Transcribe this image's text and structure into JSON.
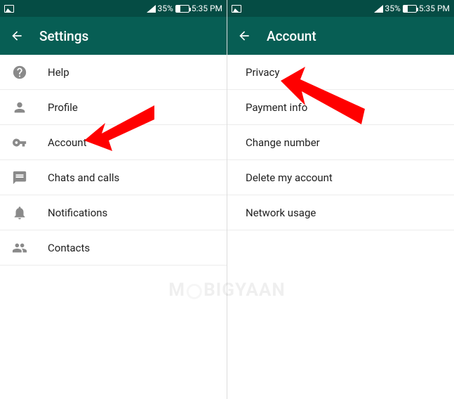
{
  "status": {
    "battery_pct": "35%",
    "time": "5:35 PM"
  },
  "left": {
    "title": "Settings",
    "items": [
      {
        "label": "Help"
      },
      {
        "label": "Profile"
      },
      {
        "label": "Account"
      },
      {
        "label": "Chats and calls"
      },
      {
        "label": "Notifications"
      },
      {
        "label": "Contacts"
      }
    ]
  },
  "right": {
    "title": "Account",
    "items": [
      {
        "label": "Privacy"
      },
      {
        "label": "Payment info"
      },
      {
        "label": "Change number"
      },
      {
        "label": "Delete my account"
      },
      {
        "label": "Network usage"
      }
    ]
  },
  "watermark": {
    "pre": "M",
    "post": "BIGYAAN"
  },
  "colors": {
    "primary": "#075e54",
    "primary_dark": "#054c44",
    "arrow": "#ff0000"
  }
}
